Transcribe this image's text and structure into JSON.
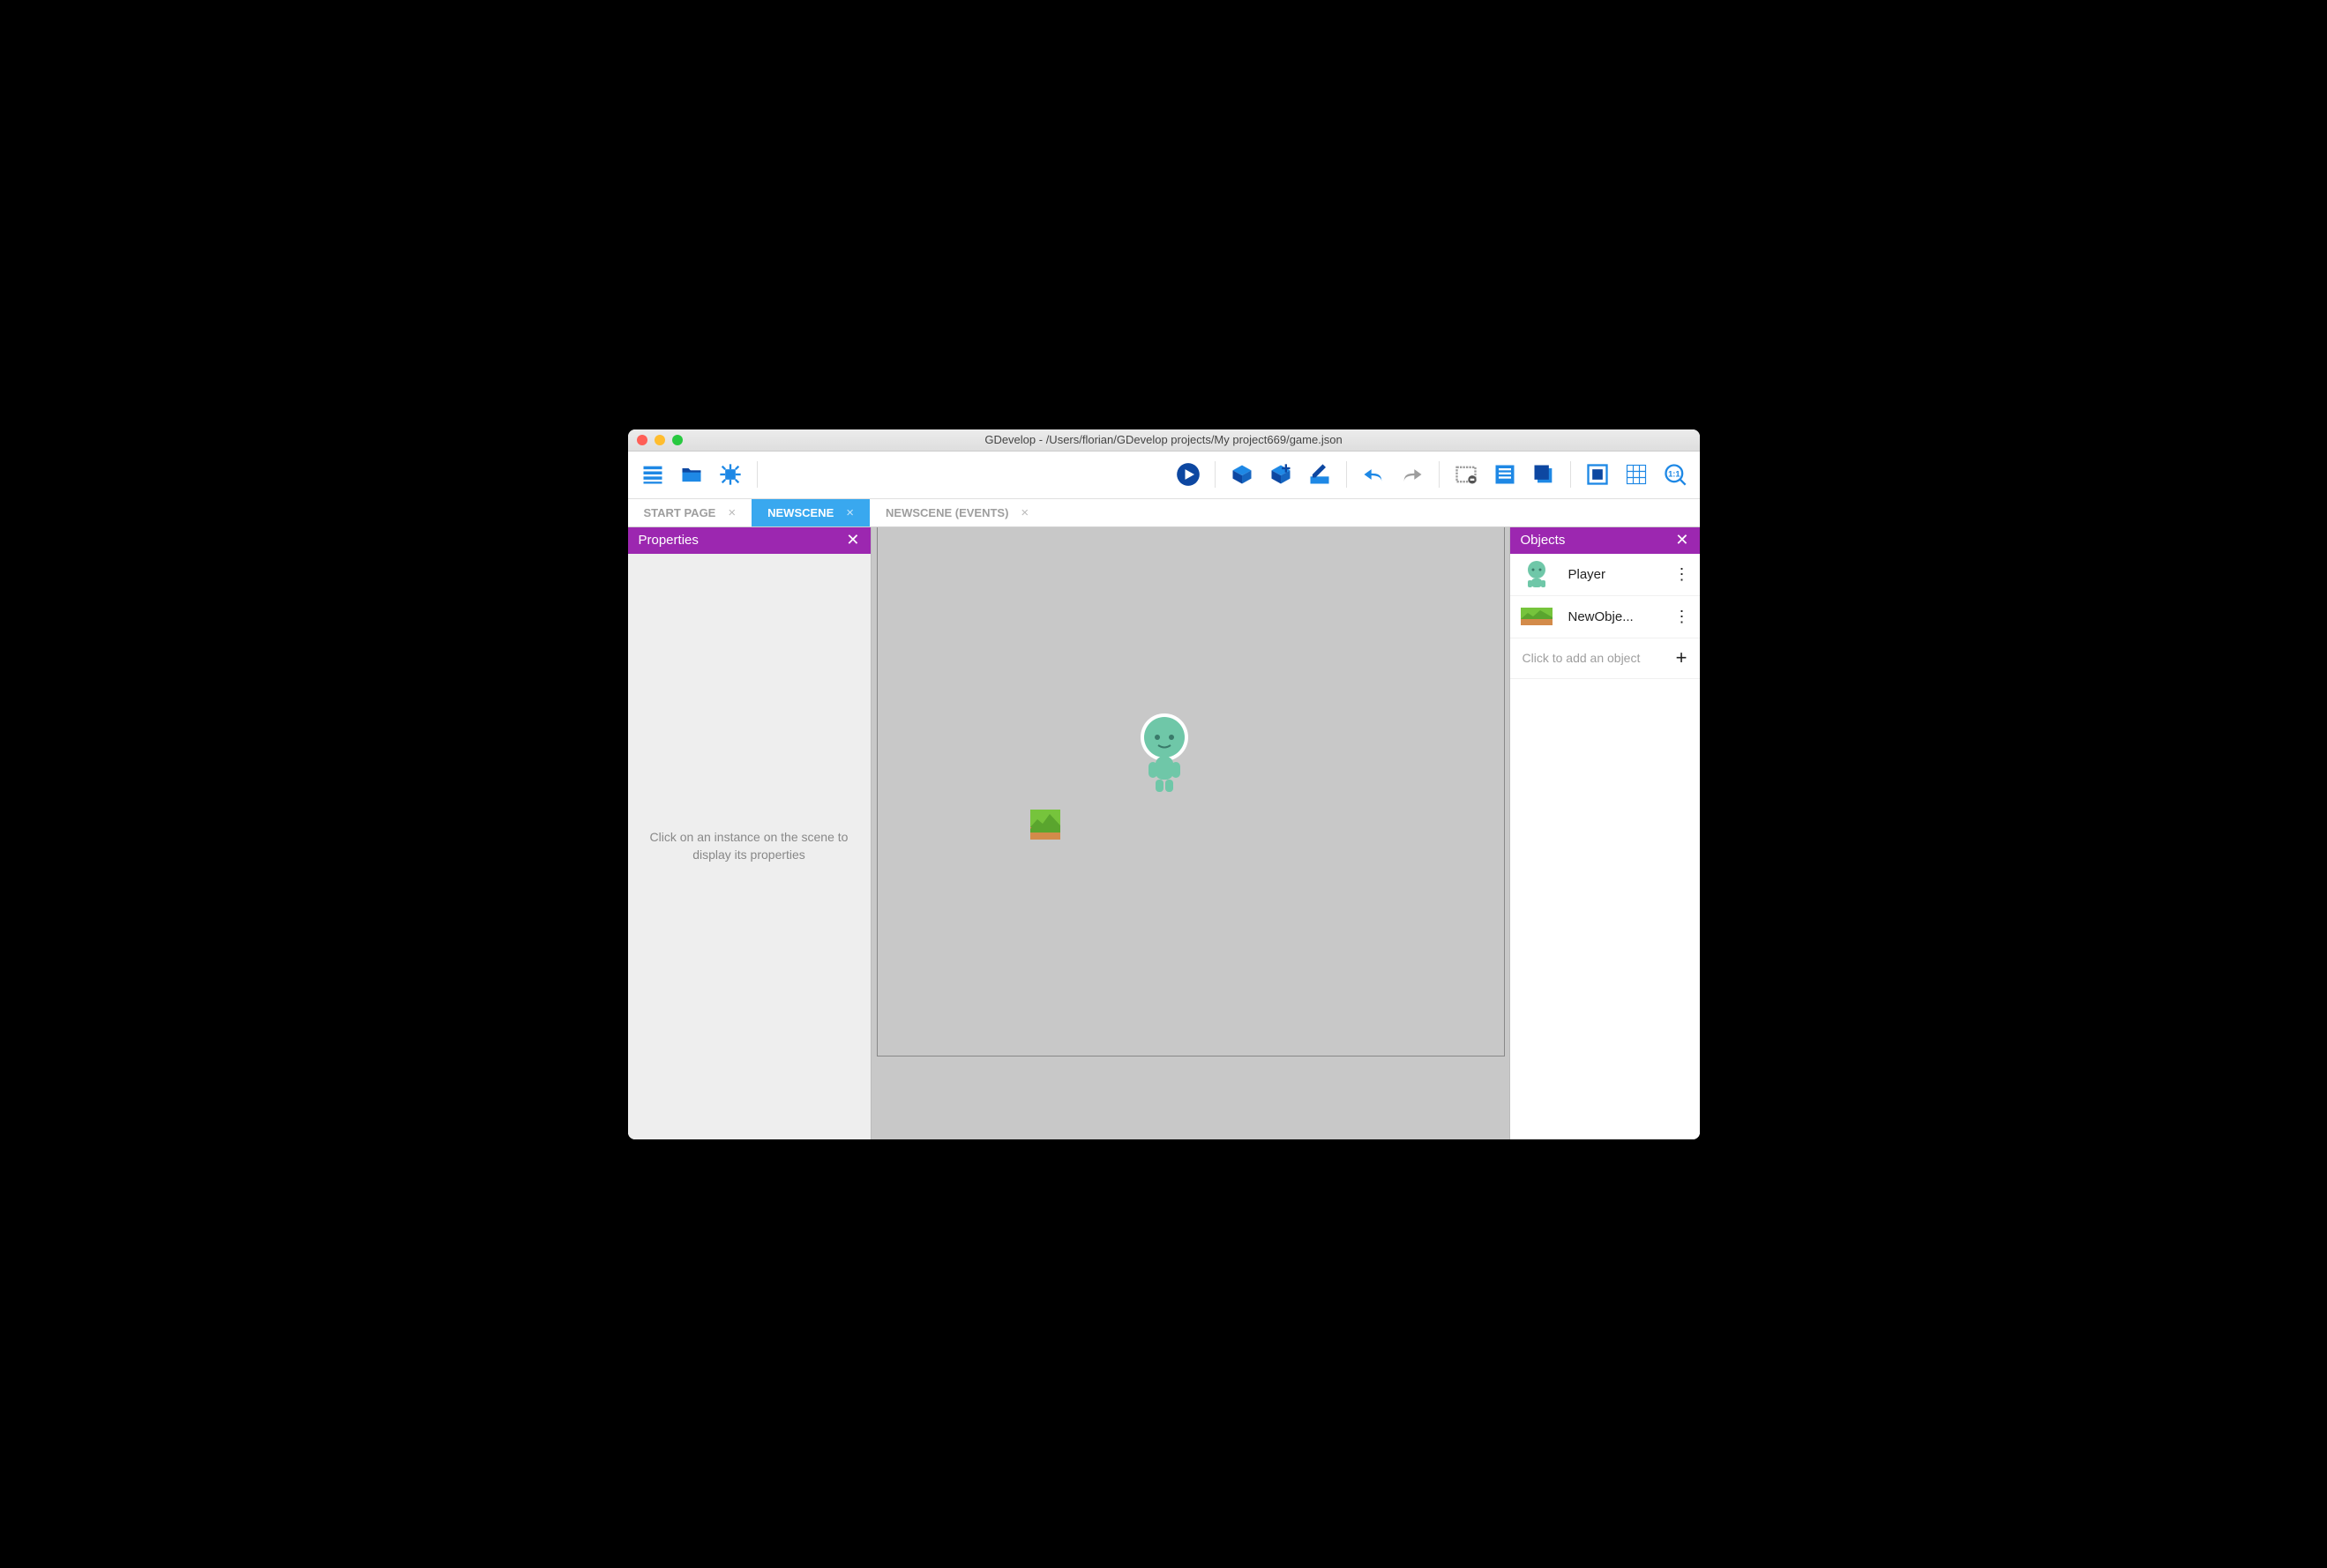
{
  "window": {
    "title": "GDevelop - /Users/florian/GDevelop projects/My project669/game.json"
  },
  "tabs": [
    {
      "label": "START PAGE",
      "active": false
    },
    {
      "label": "NEWSCENE",
      "active": true
    },
    {
      "label": "NEWSCENE (EVENTS)",
      "active": false
    }
  ],
  "panels": {
    "properties": {
      "title": "Properties",
      "placeholder": "Click on an instance on the scene to display its properties"
    },
    "objects": {
      "title": "Objects",
      "items": [
        {
          "name": "Player"
        },
        {
          "name": "NewObje..."
        }
      ],
      "add_label": "Click to add an object"
    }
  },
  "colors": {
    "accent": "#9c27b0",
    "tab_active": "#39a8ef",
    "toolbar_icon": "#1e88e5"
  }
}
